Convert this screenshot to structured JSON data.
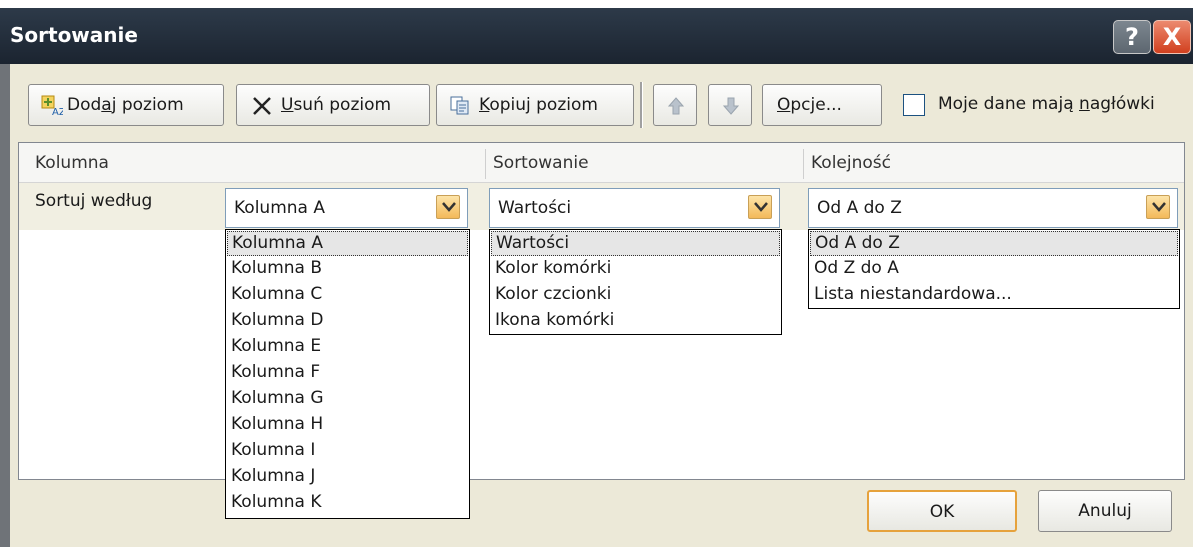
{
  "dialog": {
    "title": "Sortowanie",
    "help_glyph": "?",
    "close_glyph": "X"
  },
  "toolbar": {
    "add_level": {
      "pre": "Dod",
      "accel": "a",
      "post": "j poziom",
      "icon": "add-level-icon"
    },
    "delete_level": {
      "accel": "U",
      "post": "suń poziom",
      "icon": "delete-x-icon"
    },
    "copy_level": {
      "accel": "K",
      "post": "opiuj poziom",
      "icon": "copy-icon"
    },
    "move_up_icon": "arrow-up-icon",
    "move_down_icon": "arrow-down-icon",
    "options": {
      "accel": "O",
      "post": "pcje..."
    },
    "headers_checkbox": {
      "pre": "Moje dane mają ",
      "accel": "n",
      "post": "agłówki",
      "checked": false
    }
  },
  "grid": {
    "columns": [
      "Kolumna",
      "Sortowanie",
      "Kolejność"
    ],
    "row_label": "Sortuj według"
  },
  "column_combo": {
    "value": "Kolumna A",
    "options": [
      "Kolumna A",
      "Kolumna B",
      "Kolumna C",
      "Kolumna D",
      "Kolumna E",
      "Kolumna F",
      "Kolumna G",
      "Kolumna H",
      "Kolumna I",
      "Kolumna J",
      "Kolumna K"
    ]
  },
  "sort_on_combo": {
    "value": "Wartości",
    "options": [
      "Wartości",
      "Kolor komórki",
      "Kolor czcionki",
      "Ikona komórki"
    ]
  },
  "order_combo": {
    "value": "Od A do Z",
    "options": [
      "Od A do Z",
      "Od Z do A",
      "Lista niestandardowa..."
    ]
  },
  "footer": {
    "ok": "OK",
    "cancel": "Anuluj"
  },
  "colors": {
    "titlebar": "#1b2430",
    "dialog_bg": "#ece9d8",
    "dropdown_button": "#f3b95a",
    "ok_border": "#e6a23c"
  }
}
